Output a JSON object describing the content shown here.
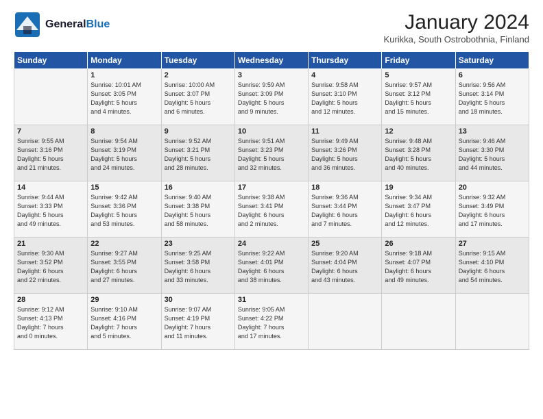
{
  "header": {
    "logo_general": "General",
    "logo_blue": "Blue",
    "title": "January 2024",
    "subtitle": "Kurikka, South Ostrobothnia, Finland"
  },
  "days_of_week": [
    "Sunday",
    "Monday",
    "Tuesday",
    "Wednesday",
    "Thursday",
    "Friday",
    "Saturday"
  ],
  "weeks": [
    [
      {
        "num": "",
        "info": ""
      },
      {
        "num": "1",
        "info": "Sunrise: 10:01 AM\nSunset: 3:05 PM\nDaylight: 5 hours\nand 4 minutes."
      },
      {
        "num": "2",
        "info": "Sunrise: 10:00 AM\nSunset: 3:07 PM\nDaylight: 5 hours\nand 6 minutes."
      },
      {
        "num": "3",
        "info": "Sunrise: 9:59 AM\nSunset: 3:09 PM\nDaylight: 5 hours\nand 9 minutes."
      },
      {
        "num": "4",
        "info": "Sunrise: 9:58 AM\nSunset: 3:10 PM\nDaylight: 5 hours\nand 12 minutes."
      },
      {
        "num": "5",
        "info": "Sunrise: 9:57 AM\nSunset: 3:12 PM\nDaylight: 5 hours\nand 15 minutes."
      },
      {
        "num": "6",
        "info": "Sunrise: 9:56 AM\nSunset: 3:14 PM\nDaylight: 5 hours\nand 18 minutes."
      }
    ],
    [
      {
        "num": "7",
        "info": "Sunrise: 9:55 AM\nSunset: 3:16 PM\nDaylight: 5 hours\nand 21 minutes."
      },
      {
        "num": "8",
        "info": "Sunrise: 9:54 AM\nSunset: 3:19 PM\nDaylight: 5 hours\nand 24 minutes."
      },
      {
        "num": "9",
        "info": "Sunrise: 9:52 AM\nSunset: 3:21 PM\nDaylight: 5 hours\nand 28 minutes."
      },
      {
        "num": "10",
        "info": "Sunrise: 9:51 AM\nSunset: 3:23 PM\nDaylight: 5 hours\nand 32 minutes."
      },
      {
        "num": "11",
        "info": "Sunrise: 9:49 AM\nSunset: 3:26 PM\nDaylight: 5 hours\nand 36 minutes."
      },
      {
        "num": "12",
        "info": "Sunrise: 9:48 AM\nSunset: 3:28 PM\nDaylight: 5 hours\nand 40 minutes."
      },
      {
        "num": "13",
        "info": "Sunrise: 9:46 AM\nSunset: 3:30 PM\nDaylight: 5 hours\nand 44 minutes."
      }
    ],
    [
      {
        "num": "14",
        "info": "Sunrise: 9:44 AM\nSunset: 3:33 PM\nDaylight: 5 hours\nand 49 minutes."
      },
      {
        "num": "15",
        "info": "Sunrise: 9:42 AM\nSunset: 3:36 PM\nDaylight: 5 hours\nand 53 minutes."
      },
      {
        "num": "16",
        "info": "Sunrise: 9:40 AM\nSunset: 3:38 PM\nDaylight: 5 hours\nand 58 minutes."
      },
      {
        "num": "17",
        "info": "Sunrise: 9:38 AM\nSunset: 3:41 PM\nDaylight: 6 hours\nand 2 minutes."
      },
      {
        "num": "18",
        "info": "Sunrise: 9:36 AM\nSunset: 3:44 PM\nDaylight: 6 hours\nand 7 minutes."
      },
      {
        "num": "19",
        "info": "Sunrise: 9:34 AM\nSunset: 3:47 PM\nDaylight: 6 hours\nand 12 minutes."
      },
      {
        "num": "20",
        "info": "Sunrise: 9:32 AM\nSunset: 3:49 PM\nDaylight: 6 hours\nand 17 minutes."
      }
    ],
    [
      {
        "num": "21",
        "info": "Sunrise: 9:30 AM\nSunset: 3:52 PM\nDaylight: 6 hours\nand 22 minutes."
      },
      {
        "num": "22",
        "info": "Sunrise: 9:27 AM\nSunset: 3:55 PM\nDaylight: 6 hours\nand 27 minutes."
      },
      {
        "num": "23",
        "info": "Sunrise: 9:25 AM\nSunset: 3:58 PM\nDaylight: 6 hours\nand 33 minutes."
      },
      {
        "num": "24",
        "info": "Sunrise: 9:22 AM\nSunset: 4:01 PM\nDaylight: 6 hours\nand 38 minutes."
      },
      {
        "num": "25",
        "info": "Sunrise: 9:20 AM\nSunset: 4:04 PM\nDaylight: 6 hours\nand 43 minutes."
      },
      {
        "num": "26",
        "info": "Sunrise: 9:18 AM\nSunset: 4:07 PM\nDaylight: 6 hours\nand 49 minutes."
      },
      {
        "num": "27",
        "info": "Sunrise: 9:15 AM\nSunset: 4:10 PM\nDaylight: 6 hours\nand 54 minutes."
      }
    ],
    [
      {
        "num": "28",
        "info": "Sunrise: 9:12 AM\nSunset: 4:13 PM\nDaylight: 7 hours\nand 0 minutes."
      },
      {
        "num": "29",
        "info": "Sunrise: 9:10 AM\nSunset: 4:16 PM\nDaylight: 7 hours\nand 5 minutes."
      },
      {
        "num": "30",
        "info": "Sunrise: 9:07 AM\nSunset: 4:19 PM\nDaylight: 7 hours\nand 11 minutes."
      },
      {
        "num": "31",
        "info": "Sunrise: 9:05 AM\nSunset: 4:22 PM\nDaylight: 7 hours\nand 17 minutes."
      },
      {
        "num": "",
        "info": ""
      },
      {
        "num": "",
        "info": ""
      },
      {
        "num": "",
        "info": ""
      }
    ]
  ]
}
